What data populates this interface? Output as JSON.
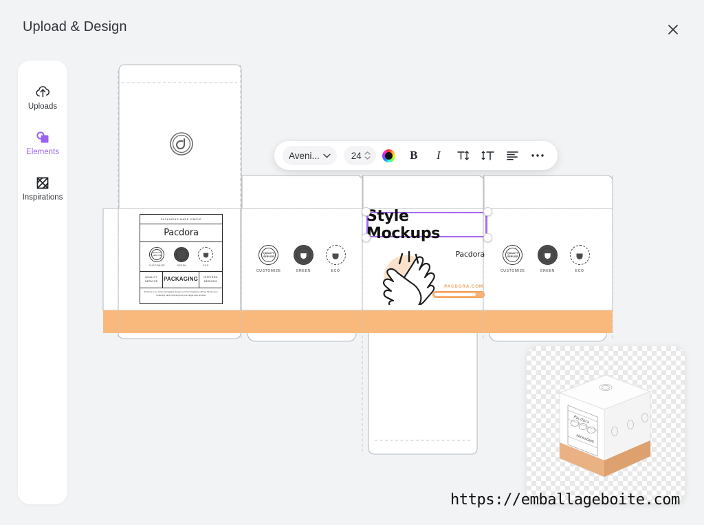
{
  "header": {
    "title": "Upload & Design",
    "close_icon": "close-icon"
  },
  "sidebar": {
    "items": [
      {
        "label": "Uploads",
        "icon": "cloud-upload-icon",
        "active": false
      },
      {
        "label": "Elements",
        "icon": "shapes-icon",
        "active": true
      },
      {
        "label": "Inspirations",
        "icon": "atom-diamond-icon",
        "active": false
      }
    ],
    "active_color": "#9a62f0"
  },
  "toolbar": {
    "font_name": "Aveni...",
    "font_dropdown_icon": "chevron-down-icon",
    "font_size": "24",
    "size_stepper_icon": "stepper-up-down-icon",
    "color_swatch": {
      "name": "color-picker",
      "value": "#111111"
    },
    "bold_label": "B",
    "italic_label": "I",
    "letter_spacing_label": "T↕",
    "line_height_label": "1T",
    "align_icon": "align-left-icon",
    "more_icon": "more-options-icon"
  },
  "text_element": {
    "value": "Style Mockups",
    "selected": true,
    "selection_color": "#a569f2",
    "handles": [
      "top-left",
      "top-right",
      "bottom-left",
      "bottom-right"
    ]
  },
  "artwork": {
    "brand": "Pacdora",
    "tagline": "PACKAGING MADE SIMPLE",
    "badges": [
      {
        "caption": "CUSTOMIZE",
        "mark": "QUALITY SERVICE"
      },
      {
        "caption": "GREEN",
        "mark": "GREEN"
      },
      {
        "caption": "ECO",
        "mark": "ECO"
      }
    ],
    "feature_row": [
      "QUALITY SERVICE",
      "PACKAGING",
      "INSPIRED DESIGNS"
    ],
    "body_text": "Pacdora is an online packaging design tool that integrates editing, 3D preview, rendering, and exporting into one single web product.",
    "website": "PACDORA.COM",
    "emblem_icon": "pacdora-leaf-emblem"
  },
  "dieline": {
    "accent_band_color": "#fab97c",
    "cut_line_color": "#b9bcc0",
    "fold_line_color": "#c3c6ca",
    "panel_fill": "#ffffff"
  },
  "preview": {
    "name": "3d-box-preview",
    "background": "transparent-checkerboard"
  },
  "watermark": {
    "text": "https://emballageboite.com"
  }
}
